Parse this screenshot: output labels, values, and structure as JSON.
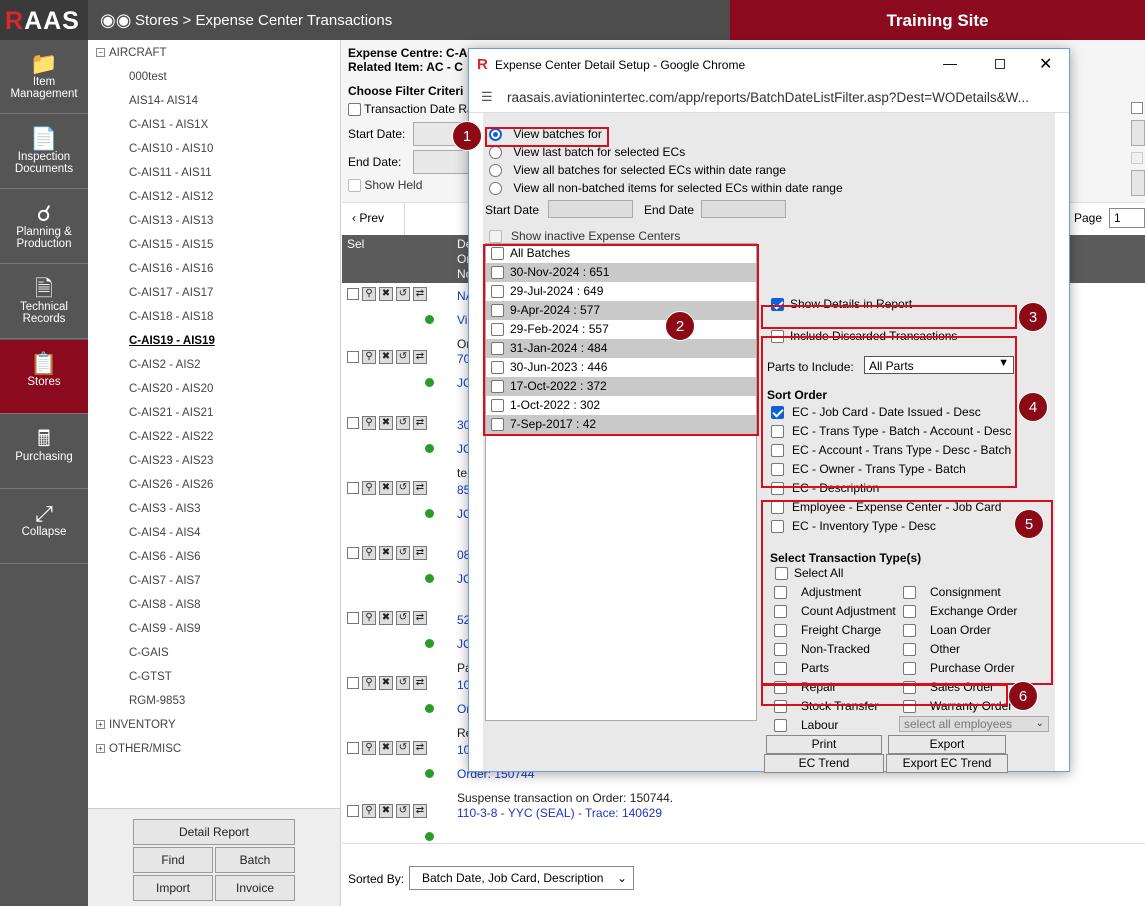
{
  "app": {
    "logo_r": "R",
    "logo_rest": "AAS",
    "breadcrumb": "Stores > Expense Center Transactions",
    "site_banner": "Training Site"
  },
  "nav": [
    {
      "label1": "Item",
      "label2": "Management",
      "icon": "folder-icon"
    },
    {
      "label1": "Inspection",
      "label2": "Documents",
      "icon": "document-icon"
    },
    {
      "label1": "Planning &",
      "label2": "Production",
      "icon": "flow-icon"
    },
    {
      "label1": "Technical",
      "label2": "Records",
      "icon": "records-icon"
    },
    {
      "label1": "Stores",
      "label2": "",
      "icon": "clipboard-icon"
    },
    {
      "label1": "Purchasing",
      "label2": "",
      "icon": "calculator-icon"
    },
    {
      "label1": "Collapse",
      "label2": "",
      "icon": "collapse-icon"
    }
  ],
  "tree": {
    "aircraft": "AIRCRAFT",
    "items": [
      "000test",
      "AIS14- AIS14",
      "C-AIS1 - AIS1X",
      "C-AIS10 - AIS10",
      "C-AIS11 - AIS11",
      "C-AIS12 - AIS12",
      "C-AIS13 - AIS13",
      "C-AIS15 - AIS15",
      "C-AIS16 - AIS16",
      "C-AIS17 - AIS17",
      "C-AIS18 - AIS18",
      "C-AIS19 - AIS19",
      "C-AIS2 - AIS2",
      "C-AIS20 - AIS20",
      "C-AIS21 - AIS21",
      "C-AIS22 - AIS22",
      "C-AIS23 - AIS23",
      "C-AIS26 - AIS26",
      "C-AIS3 - AIS3",
      "C-AIS4 - AIS4",
      "C-AIS6 - AIS6",
      "C-AIS7 - AIS7",
      "C-AIS8 - AIS8",
      "C-AIS9 - AIS9",
      "C-GAIS",
      "C-GTST",
      "RGM-9853"
    ],
    "selected": "C-AIS19 - AIS19",
    "inventory": "INVENTORY",
    "other": "OTHER/MISC"
  },
  "panel_buttons": {
    "detail_report": "Detail Report",
    "find": "Find",
    "batch": "Batch",
    "import": "Import",
    "invoice": "Invoice"
  },
  "main": {
    "expense_centre": "Expense Centre: C-A",
    "related_item": "Related Item: AC - C",
    "filter_criteria": "Choose Filter Criteri",
    "transaction_date": "Transaction Date Ra",
    "start_date": "Start Date:",
    "end_date": "End Date:",
    "show_held": "Show Held",
    "prev": "‹ Prev",
    "page_label": "Page",
    "page_value": "1",
    "sel_header": "Sel",
    "hdr_de": "De",
    "hdr_or": "Or",
    "hdr_no": "No",
    "rows": [
      {
        "l1": "NA",
        "l2": "Vi",
        "l3": "Or"
      },
      {
        "l1": "70",
        "l2": "JC",
        "l3": ""
      },
      {
        "l1": "30",
        "l2": "JC",
        "l3": "te"
      },
      {
        "l1": "85",
        "l2": "JC",
        "l3": ""
      },
      {
        "l1": "08",
        "l2": "JC",
        "l3": ""
      },
      {
        "l1": "52",
        "l2": "JC",
        "l3": "Pa"
      },
      {
        "l1": "10",
        "l2": "Or",
        "l3": "Re"
      },
      {
        "l1": "10",
        "l2": "Order: 150744",
        "l3": "Suspense transaction on Order: 150744."
      },
      {
        "l1": "110-3-8 - YYC (SEAL) - Trace: 140629",
        "l2": "",
        "l3": ""
      }
    ],
    "sorted_by_label": "Sorted By:",
    "sorted_by_value": "Batch Date, Job Card, Description"
  },
  "dialog": {
    "title": "Expense Center Detail Setup - Google Chrome",
    "url": "raasais.aviationintertec.com/app/reports/BatchDateListFilter.asp?Dest=WODetails&W...",
    "radios": [
      "View batches for",
      "View last batch for selected ECs",
      "View all batches for selected ECs within date range",
      "View all non-batched items for selected ECs within date range"
    ],
    "start_date": "Start Date",
    "end_date": "End Date",
    "show_inactive": "Show inactive Expense Centers",
    "batches": [
      "All Batches",
      "30-Nov-2024 : 651",
      "29-Jul-2024 : 649",
      "9-Apr-2024 : 577",
      "29-Feb-2024 : 557",
      "31-Jan-2024 : 484",
      "30-Jun-2023 : 446",
      "17-Oct-2022 : 372",
      "1-Oct-2022 : 302",
      "7-Sep-2017 : 42"
    ],
    "show_details": "Show Details in Report",
    "include_discarded": "Include Discarded Transactions",
    "parts_label": "Parts to Include:",
    "parts_value": "All Parts",
    "sort_order_title": "Sort Order",
    "sort_orders": [
      "EC - Job Card - Date Issued - Desc",
      "EC - Trans Type - Batch - Account - Desc",
      "EC - Account - Trans Type - Desc - Batch",
      "EC - Owner - Trans Type - Batch",
      "EC - Description",
      "Employee - Expense Center - Job Card",
      "EC - Inventory Type - Desc"
    ],
    "trans_title": "Select Transaction Type(s)",
    "select_all": "Select All",
    "trans_left": [
      "Adjustment",
      "Count Adjustment",
      "Freight Charge",
      "Non-Tracked",
      "Parts",
      "Repair",
      "Stock Transfer",
      "Labour"
    ],
    "trans_right": [
      "Consignment",
      "Exchange Order",
      "Loan Order",
      "Other",
      "Purchase Order",
      "Sales Order",
      "Warranty Order"
    ],
    "employee_select": "select all employees",
    "print": "Print",
    "export": "Export",
    "ec_trend": "EC Trend",
    "export_ec_trend": "Export EC Trend",
    "badges": [
      "1",
      "2",
      "3",
      "4",
      "5",
      "6"
    ]
  },
  "colors": {
    "brand_red": "#8c0a1e",
    "nav_gray": "#555555",
    "link_blue": "#1a37c9",
    "annot_red": "#d4101e"
  }
}
